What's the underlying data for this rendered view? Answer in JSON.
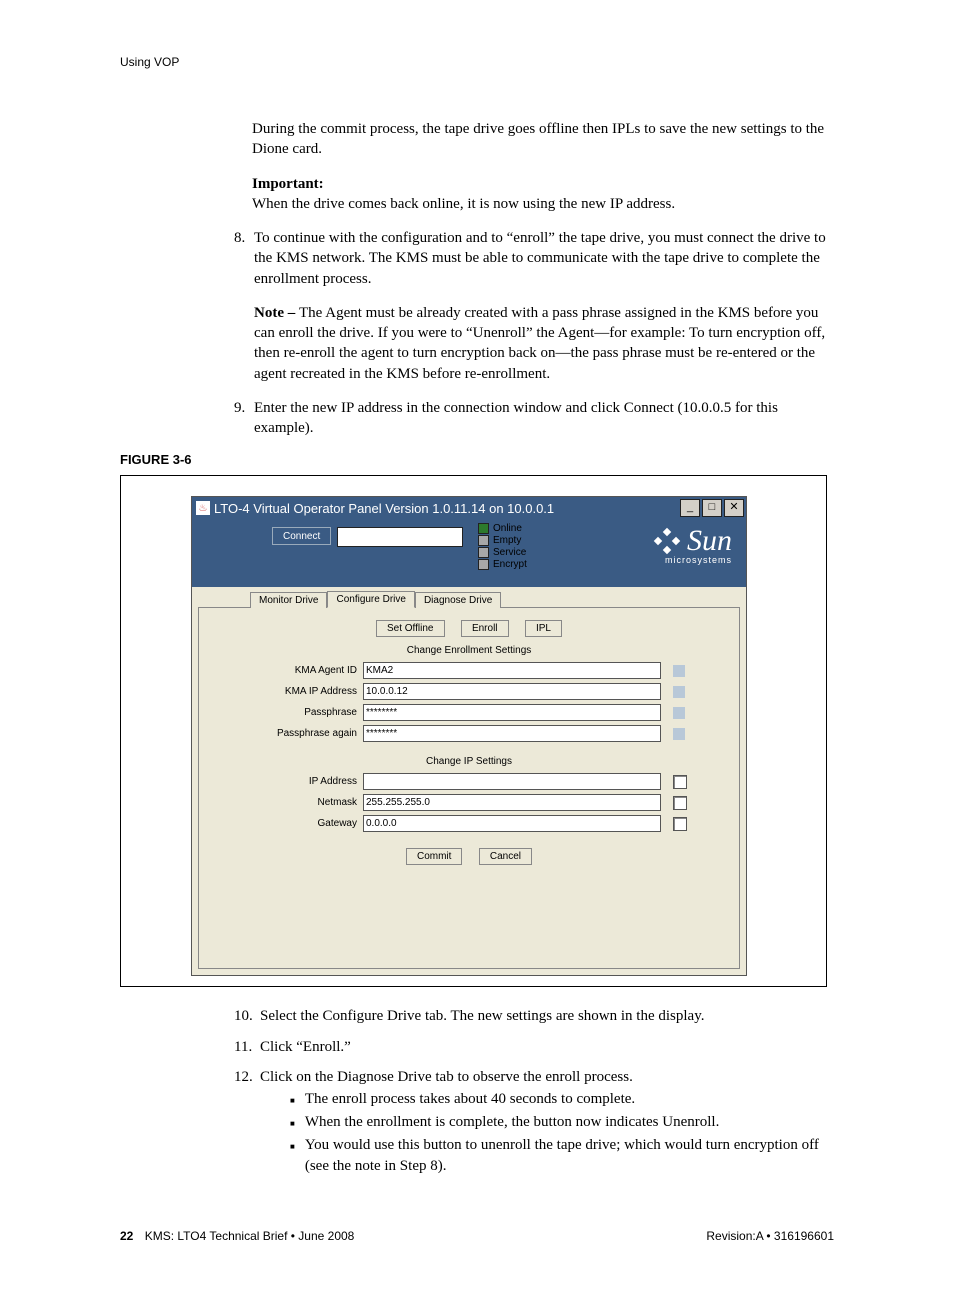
{
  "header": {
    "running_head": "Using VOP"
  },
  "intro": {
    "p1": "During the commit process, the tape drive goes offline then IPLs to save the new settings to the Dione card.",
    "important_label": "Important:",
    "important_text": "When the drive comes back online, it is now using the new IP address."
  },
  "step8": {
    "num": "8.",
    "p1": "To continue with the configuration and to “enroll” the tape drive, you must connect the drive to the KMS network. The KMS must be able to communicate with the tape drive to complete the enrollment process.",
    "note_label": "Note – ",
    "note_text": "The Agent must be already created with a pass phrase assigned in the KMS before you can enroll the drive. If you were to “Unenroll” the Agent—for example: To turn encryption off, then re-enroll the agent to turn encryption back on—the pass phrase must be re-entered or the agent recreated in the KMS before re-enrollment."
  },
  "step9": {
    "num": "9.",
    "text": "Enter the new IP address in the connection window and click Connect (10.0.0.5 for this example)."
  },
  "figure_label": "FIGURE 3-6",
  "app": {
    "title": "LTO-4 Virtual Operator Panel Version 1.0.11.14 on 10.0.0.1",
    "win_min": "_",
    "win_max": "□",
    "win_close": "✕",
    "connect_btn": "Connect",
    "status": {
      "online": "Online",
      "empty": "Empty",
      "service": "Service",
      "encrypt": "Encrypt"
    },
    "logo": {
      "big": "Sun",
      "small": "microsystems"
    },
    "tabs": {
      "monitor": "Monitor Drive",
      "configure": "Configure Drive",
      "diagnose": "Diagnose Drive"
    },
    "buttons": {
      "offline": "Set Offline",
      "enroll": "Enroll",
      "ipl": "IPL",
      "commit": "Commit",
      "cancel": "Cancel"
    },
    "sections": {
      "enroll": "Change Enrollment Settings",
      "ip": "Change IP Settings"
    },
    "fields": {
      "agent_id": {
        "label": "KMA Agent ID",
        "value": "KMA2"
      },
      "kma_ip": {
        "label": "KMA IP Address",
        "value": "10.0.0.12"
      },
      "pass": {
        "label": "Passphrase",
        "value": "********"
      },
      "pass2": {
        "label": "Passphrase again",
        "value": "********"
      },
      "ip": {
        "label": "IP Address",
        "value": ""
      },
      "netmask": {
        "label": "Netmask",
        "value": "255.255.255.0"
      },
      "gateway": {
        "label": "Gateway",
        "value": "0.0.0.0"
      }
    }
  },
  "step10": {
    "num": "10.",
    "text": "Select the Configure Drive tab. The new settings are shown in the display."
  },
  "step11": {
    "num": "11.",
    "text": "Click “Enroll.”"
  },
  "step12": {
    "num": "12.",
    "text": "Click on the Diagnose Drive tab to observe the enroll process.",
    "b1": "The enroll process takes about 40 seconds to complete.",
    "b2": "When the enrollment is complete, the button now indicates Unenroll.",
    "b3": "You would use this button to unenroll the tape drive; which would turn encryption off (see the note in Step 8)."
  },
  "footer": {
    "left_page": "22",
    "left_text": "KMS: LTO4 Technical Brief  •  June 2008",
    "right_text": "Revision:A  •  316196601"
  }
}
